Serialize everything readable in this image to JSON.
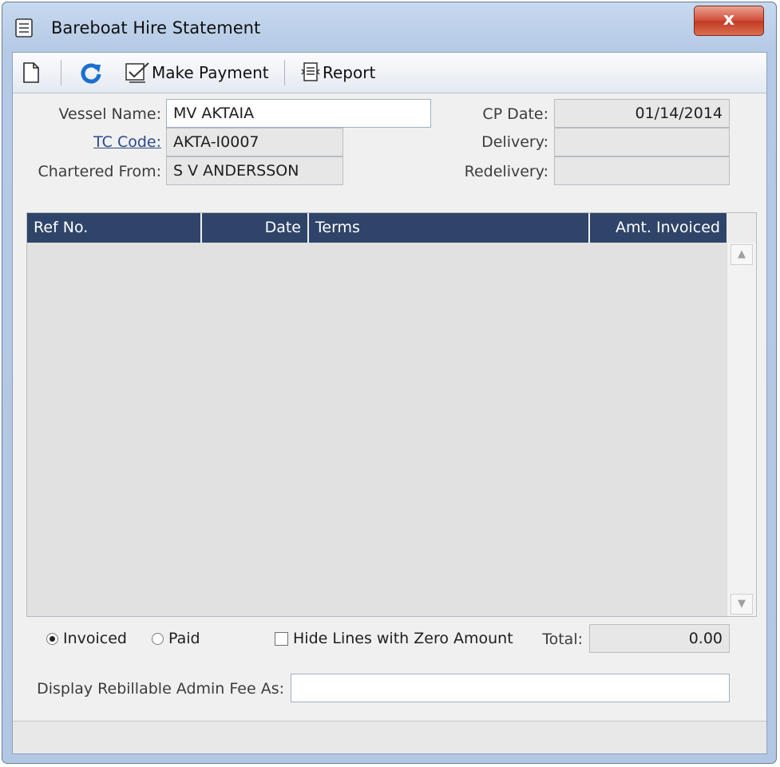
{
  "window": {
    "title": "Bareboat Hire Statement",
    "close_label": "x"
  },
  "toolbar": {
    "make_payment_label": "Make Payment",
    "report_label": "Report"
  },
  "form": {
    "vessel_name_label": "Vessel Name:",
    "vessel_name_value": "MV AKTAIA",
    "tc_code_label": "TC Code:",
    "tc_code_value": "AKTA-I0007",
    "chartered_from_label": "Chartered From:",
    "chartered_from_value": "S V ANDERSSON",
    "cp_date_label": "CP Date:",
    "cp_date_value": "01/14/2014",
    "delivery_label": "Delivery:",
    "delivery_value": "",
    "redelivery_label": "Redelivery:",
    "redelivery_value": ""
  },
  "grid": {
    "columns": [
      "Ref No.",
      "Date",
      "Terms",
      "Amt. Invoiced"
    ],
    "rows": []
  },
  "options": {
    "invoiced_label": "Invoiced",
    "paid_label": "Paid",
    "selected": "Invoiced",
    "hide_zero_label": "Hide Lines with Zero Amount",
    "hide_zero_checked": false,
    "total_label": "Total:",
    "total_value": "0.00"
  },
  "admin_fee": {
    "label": "Display Rebillable Admin Fee As:",
    "value": ""
  },
  "colors": {
    "grid_header": "#2f4469",
    "close_button": "#c43a24",
    "window_frame": "#b5cae6"
  },
  "icons": [
    "document-icon",
    "new-icon",
    "refresh-icon",
    "make-payment-icon",
    "report-icon"
  ]
}
